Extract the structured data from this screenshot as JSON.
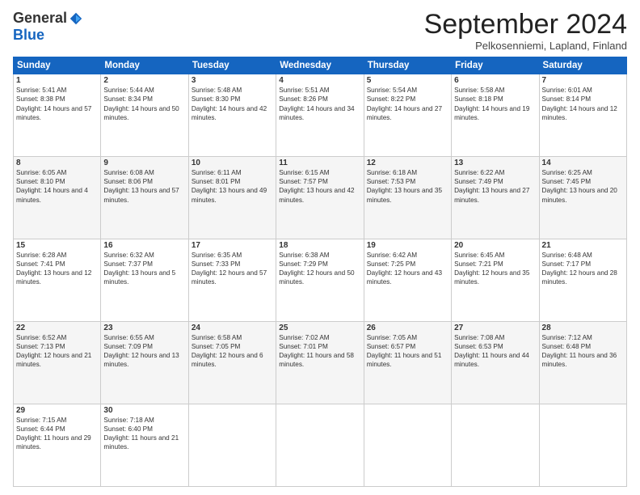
{
  "header": {
    "logo_general": "General",
    "logo_blue": "Blue",
    "title": "September 2024",
    "location": "Pelkosenniemi, Lapland, Finland"
  },
  "days_of_week": [
    "Sunday",
    "Monday",
    "Tuesday",
    "Wednesday",
    "Thursday",
    "Friday",
    "Saturday"
  ],
  "weeks": [
    [
      {
        "day": "1",
        "sunrise": "Sunrise: 5:41 AM",
        "sunset": "Sunset: 8:38 PM",
        "daylight": "Daylight: 14 hours and 57 minutes."
      },
      {
        "day": "2",
        "sunrise": "Sunrise: 5:44 AM",
        "sunset": "Sunset: 8:34 PM",
        "daylight": "Daylight: 14 hours and 50 minutes."
      },
      {
        "day": "3",
        "sunrise": "Sunrise: 5:48 AM",
        "sunset": "Sunset: 8:30 PM",
        "daylight": "Daylight: 14 hours and 42 minutes."
      },
      {
        "day": "4",
        "sunrise": "Sunrise: 5:51 AM",
        "sunset": "Sunset: 8:26 PM",
        "daylight": "Daylight: 14 hours and 34 minutes."
      },
      {
        "day": "5",
        "sunrise": "Sunrise: 5:54 AM",
        "sunset": "Sunset: 8:22 PM",
        "daylight": "Daylight: 14 hours and 27 minutes."
      },
      {
        "day": "6",
        "sunrise": "Sunrise: 5:58 AM",
        "sunset": "Sunset: 8:18 PM",
        "daylight": "Daylight: 14 hours and 19 minutes."
      },
      {
        "day": "7",
        "sunrise": "Sunrise: 6:01 AM",
        "sunset": "Sunset: 8:14 PM",
        "daylight": "Daylight: 14 hours and 12 minutes."
      }
    ],
    [
      {
        "day": "8",
        "sunrise": "Sunrise: 6:05 AM",
        "sunset": "Sunset: 8:10 PM",
        "daylight": "Daylight: 14 hours and 4 minutes."
      },
      {
        "day": "9",
        "sunrise": "Sunrise: 6:08 AM",
        "sunset": "Sunset: 8:06 PM",
        "daylight": "Daylight: 13 hours and 57 minutes."
      },
      {
        "day": "10",
        "sunrise": "Sunrise: 6:11 AM",
        "sunset": "Sunset: 8:01 PM",
        "daylight": "Daylight: 13 hours and 49 minutes."
      },
      {
        "day": "11",
        "sunrise": "Sunrise: 6:15 AM",
        "sunset": "Sunset: 7:57 PM",
        "daylight": "Daylight: 13 hours and 42 minutes."
      },
      {
        "day": "12",
        "sunrise": "Sunrise: 6:18 AM",
        "sunset": "Sunset: 7:53 PM",
        "daylight": "Daylight: 13 hours and 35 minutes."
      },
      {
        "day": "13",
        "sunrise": "Sunrise: 6:22 AM",
        "sunset": "Sunset: 7:49 PM",
        "daylight": "Daylight: 13 hours and 27 minutes."
      },
      {
        "day": "14",
        "sunrise": "Sunrise: 6:25 AM",
        "sunset": "Sunset: 7:45 PM",
        "daylight": "Daylight: 13 hours and 20 minutes."
      }
    ],
    [
      {
        "day": "15",
        "sunrise": "Sunrise: 6:28 AM",
        "sunset": "Sunset: 7:41 PM",
        "daylight": "Daylight: 13 hours and 12 minutes."
      },
      {
        "day": "16",
        "sunrise": "Sunrise: 6:32 AM",
        "sunset": "Sunset: 7:37 PM",
        "daylight": "Daylight: 13 hours and 5 minutes."
      },
      {
        "day": "17",
        "sunrise": "Sunrise: 6:35 AM",
        "sunset": "Sunset: 7:33 PM",
        "daylight": "Daylight: 12 hours and 57 minutes."
      },
      {
        "day": "18",
        "sunrise": "Sunrise: 6:38 AM",
        "sunset": "Sunset: 7:29 PM",
        "daylight": "Daylight: 12 hours and 50 minutes."
      },
      {
        "day": "19",
        "sunrise": "Sunrise: 6:42 AM",
        "sunset": "Sunset: 7:25 PM",
        "daylight": "Daylight: 12 hours and 43 minutes."
      },
      {
        "day": "20",
        "sunrise": "Sunrise: 6:45 AM",
        "sunset": "Sunset: 7:21 PM",
        "daylight": "Daylight: 12 hours and 35 minutes."
      },
      {
        "day": "21",
        "sunrise": "Sunrise: 6:48 AM",
        "sunset": "Sunset: 7:17 PM",
        "daylight": "Daylight: 12 hours and 28 minutes."
      }
    ],
    [
      {
        "day": "22",
        "sunrise": "Sunrise: 6:52 AM",
        "sunset": "Sunset: 7:13 PM",
        "daylight": "Daylight: 12 hours and 21 minutes."
      },
      {
        "day": "23",
        "sunrise": "Sunrise: 6:55 AM",
        "sunset": "Sunset: 7:09 PM",
        "daylight": "Daylight: 12 hours and 13 minutes."
      },
      {
        "day": "24",
        "sunrise": "Sunrise: 6:58 AM",
        "sunset": "Sunset: 7:05 PM",
        "daylight": "Daylight: 12 hours and 6 minutes."
      },
      {
        "day": "25",
        "sunrise": "Sunrise: 7:02 AM",
        "sunset": "Sunset: 7:01 PM",
        "daylight": "Daylight: 11 hours and 58 minutes."
      },
      {
        "day": "26",
        "sunrise": "Sunrise: 7:05 AM",
        "sunset": "Sunset: 6:57 PM",
        "daylight": "Daylight: 11 hours and 51 minutes."
      },
      {
        "day": "27",
        "sunrise": "Sunrise: 7:08 AM",
        "sunset": "Sunset: 6:53 PM",
        "daylight": "Daylight: 11 hours and 44 minutes."
      },
      {
        "day": "28",
        "sunrise": "Sunrise: 7:12 AM",
        "sunset": "Sunset: 6:48 PM",
        "daylight": "Daylight: 11 hours and 36 minutes."
      }
    ],
    [
      {
        "day": "29",
        "sunrise": "Sunrise: 7:15 AM",
        "sunset": "Sunset: 6:44 PM",
        "daylight": "Daylight: 11 hours and 29 minutes."
      },
      {
        "day": "30",
        "sunrise": "Sunrise: 7:18 AM",
        "sunset": "Sunset: 6:40 PM",
        "daylight": "Daylight: 11 hours and 21 minutes."
      },
      null,
      null,
      null,
      null,
      null
    ]
  ]
}
